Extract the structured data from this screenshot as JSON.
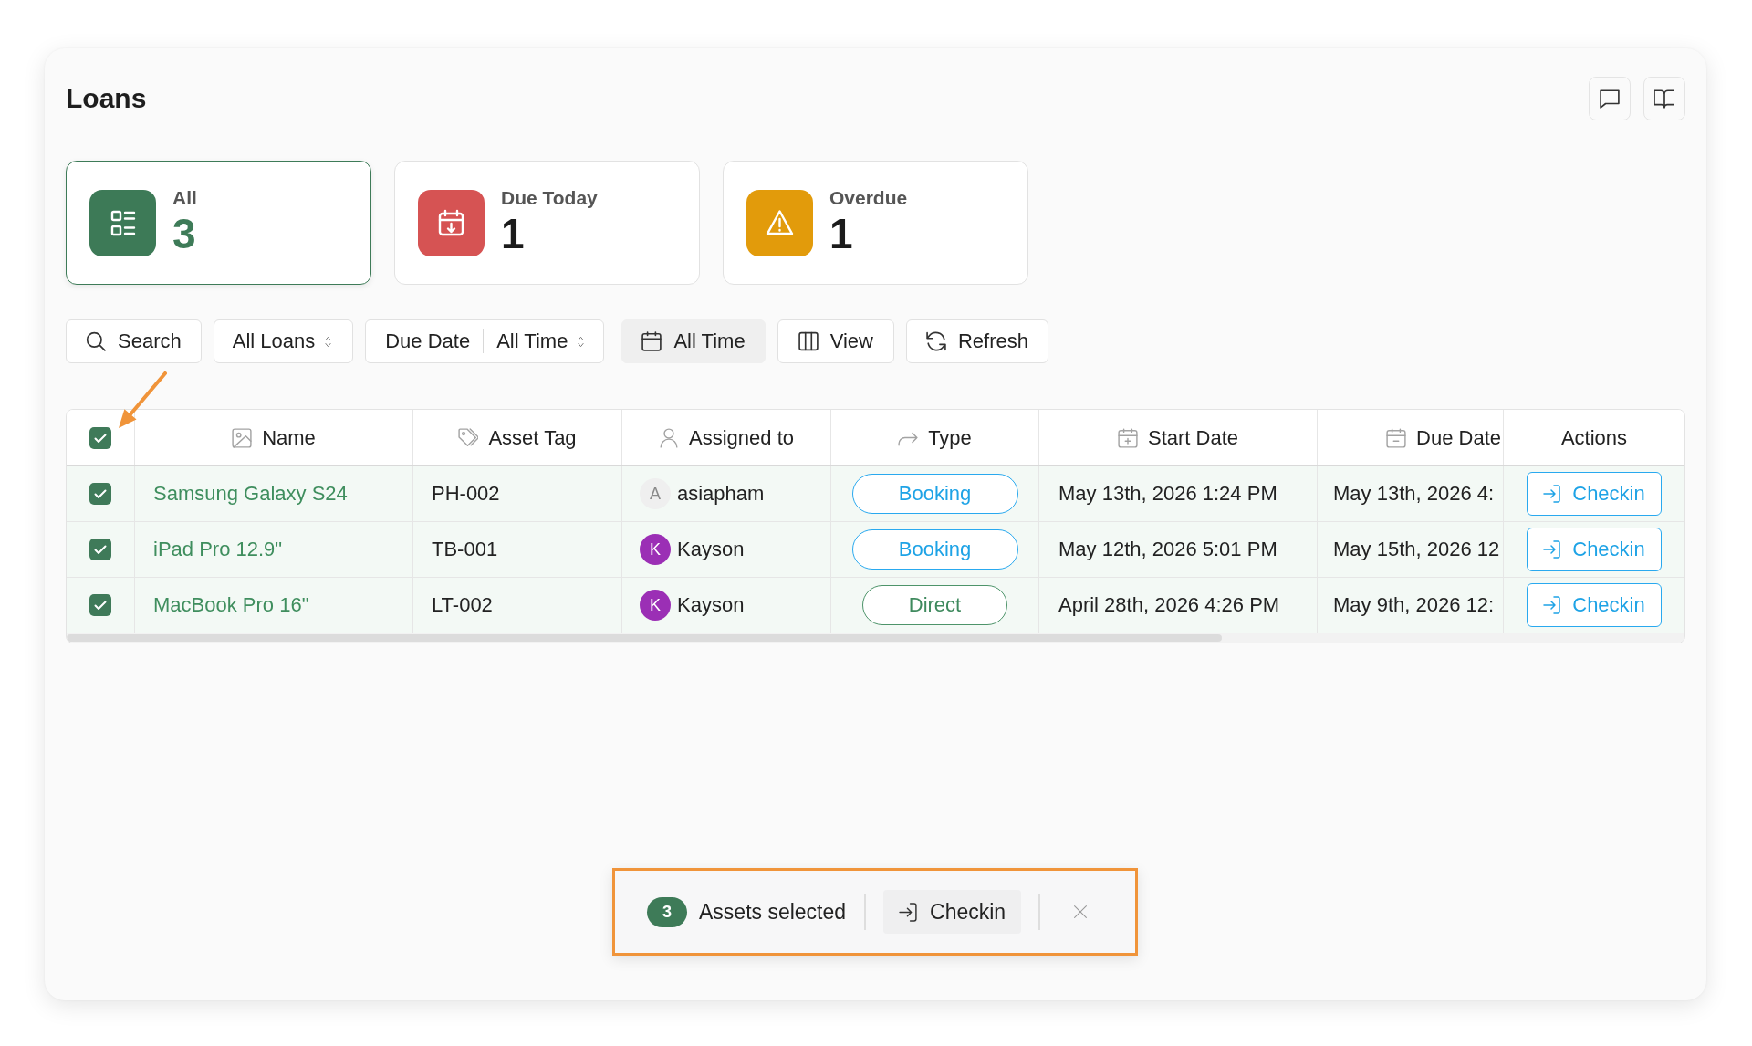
{
  "page": {
    "title": "Loans"
  },
  "summary_cards": [
    {
      "kind": "all",
      "label": "All",
      "count": "3",
      "color": "#3d7a57",
      "selected": true
    },
    {
      "kind": "due_today",
      "label": "Due Today",
      "count": "1",
      "color": "#d65353",
      "selected": false
    },
    {
      "kind": "overdue",
      "label": "Overdue",
      "count": "1",
      "color": "#e29b0b",
      "selected": false
    }
  ],
  "toolbar": [
    {
      "kind": "search",
      "label": "Search"
    },
    {
      "kind": "select",
      "label": "All Loans"
    },
    {
      "kind": "field_select",
      "label": "Due Date",
      "value": "All Time"
    },
    {
      "kind": "date_range",
      "label": "All Time"
    },
    {
      "kind": "columns",
      "label": "View"
    },
    {
      "kind": "refresh",
      "label": "Refresh"
    }
  ],
  "table": {
    "select_all": {
      "checked": true
    },
    "columns": [
      {
        "kind": "name",
        "label": "Name"
      },
      {
        "kind": "asset_tag",
        "label": "Asset Tag"
      },
      {
        "kind": "assigned_to",
        "label": "Assigned to"
      },
      {
        "kind": "type",
        "label": "Type"
      },
      {
        "kind": "start_date",
        "label": "Start Date"
      },
      {
        "kind": "due_date",
        "label": "Due Date"
      },
      {
        "kind": "actions",
        "label": "Actions"
      }
    ],
    "rows": [
      {
        "selected": true,
        "name": "Samsung Galaxy S24",
        "asset_tag": "PH-002",
        "assigned_to": {
          "name": "asiapham",
          "initial": "A",
          "color": "#efefef"
        },
        "type": {
          "kind": "booking",
          "label": "Booking"
        },
        "start_date": "May 13th, 2026 1:24 PM",
        "due_date": "May 13th, 2026 4:",
        "action": "Checkin"
      },
      {
        "selected": true,
        "name": "iPad Pro 12.9\"",
        "asset_tag": "TB-001",
        "assigned_to": {
          "name": "Kayson",
          "initial": "K",
          "color": "#9b2fb5"
        },
        "type": {
          "kind": "booking",
          "label": "Booking"
        },
        "start_date": "May 12th, 2026 5:01 PM",
        "due_date": "May 15th, 2026 12",
        "action": "Checkin"
      },
      {
        "selected": true,
        "name": "MacBook Pro 16\"",
        "asset_tag": "LT-002",
        "assigned_to": {
          "name": "Kayson",
          "initial": "K",
          "color": "#9b2fb5"
        },
        "type": {
          "kind": "direct",
          "label": "Direct"
        },
        "start_date": "April 28th, 2026 4:26 PM",
        "due_date": "May 9th, 2026 12:",
        "action": "Checkin"
      }
    ]
  },
  "bulk_actions": {
    "count": "3",
    "label": "Assets selected",
    "action": "Checkin"
  }
}
